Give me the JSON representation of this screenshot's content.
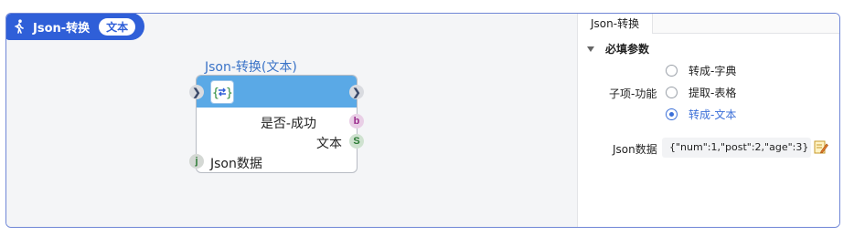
{
  "header": {
    "title": "Json-转换",
    "tag": "文本"
  },
  "node": {
    "title": "Json-转换(文本)",
    "outputs": [
      {
        "label": "是否-成功",
        "port": "b"
      },
      {
        "label": "文本",
        "port": "S"
      }
    ],
    "inputs": [
      {
        "label": "Json数据",
        "port": "j"
      }
    ]
  },
  "panel": {
    "tab": "Json-转换",
    "section": "必填参数",
    "sub_function_label": "子项-功能",
    "options": [
      {
        "label": "转成-字典",
        "selected": false
      },
      {
        "label": "提取-表格",
        "selected": false
      },
      {
        "label": "转成-文本",
        "selected": true
      }
    ],
    "json_label": "Json数据",
    "json_value": "{\"num\":1,\"post\":2,\"age\":3}"
  },
  "colors": {
    "accent": "#2f5fd8",
    "node_bar": "#5aa9e6",
    "selected": "#3b6fd8"
  }
}
